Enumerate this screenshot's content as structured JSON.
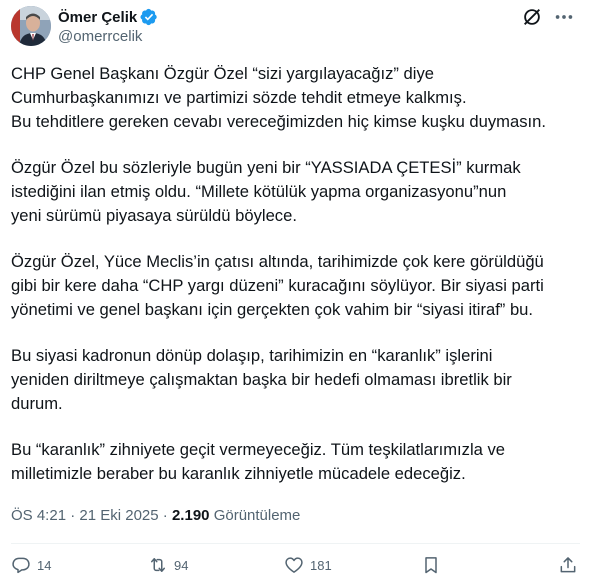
{
  "author": {
    "display_name": "Ömer Çelik",
    "handle": "@omerrcelik",
    "verified_color": "#1d9bf0"
  },
  "tweet": {
    "paragraphs": [
      {
        "lines": [
          "CHP Genel Başkanı Özgür Özel “sizi yargılayacağız” diye",
          "Cumhurbaşkanımızı ve partimizi sözde tehdit etmeye kalkmış.",
          "Bu tehditlere gereken cevabı vereceğimizden hiç kimse kuşku duymasın."
        ]
      },
      {
        "lines": [
          "Özgür Özel bu sözleriyle bugün yeni bir “YASSIADA ÇETESİ” kurmak",
          "istediğini ilan etmiş oldu. “Millete kötülük yapma organizasyonu”nun",
          "yeni sürümü piyasaya sürüldü böylece."
        ]
      },
      {
        "lines": [
          "Özgür Özel, Yüce Meclis’in çatısı altında, tarihimizde çok kere görüldüğü",
          "gibi bir kere daha “CHP yargı düzeni”  kuracağını söylüyor. Bir siyasi parti",
          "yönetimi ve genel başkanı için gerçekten çok vahim bir “siyasi itiraf” bu."
        ]
      },
      {
        "lines": [
          "Bu siyasi kadronun dönüp dolaşıp, tarihimizin en “karanlık” işlerini",
          "yeniden diriltmeye çalışmaktan başka bir hedefi olmaması ibretlik bir",
          "durum."
        ]
      },
      {
        "lines": [
          "Bu “karanlık” zihniyete geçit vermeyeceğiz. Tüm teşkilatlarımızla ve",
          "milletimizle beraber bu karanlık zihniyetle mücadele edeceğiz."
        ]
      }
    ]
  },
  "meta": {
    "time": "ÖS 4:21",
    "separator": "·",
    "date": "21 Eki 2025",
    "views_count": "2.190",
    "views_label": "Görüntüleme"
  },
  "actions": {
    "replies": "14",
    "reposts": "94",
    "likes": "181"
  },
  "icons": {
    "reply": "reply-icon",
    "repost": "repost-icon",
    "like": "heart-icon",
    "bookmark": "bookmark-icon",
    "share": "share-icon",
    "grok": "grok-icon",
    "more": "more-icon",
    "verified": "verified-badge-icon"
  },
  "colors": {
    "text": "#0f1419",
    "secondary": "#536471",
    "verified": "#1d9bf0"
  }
}
